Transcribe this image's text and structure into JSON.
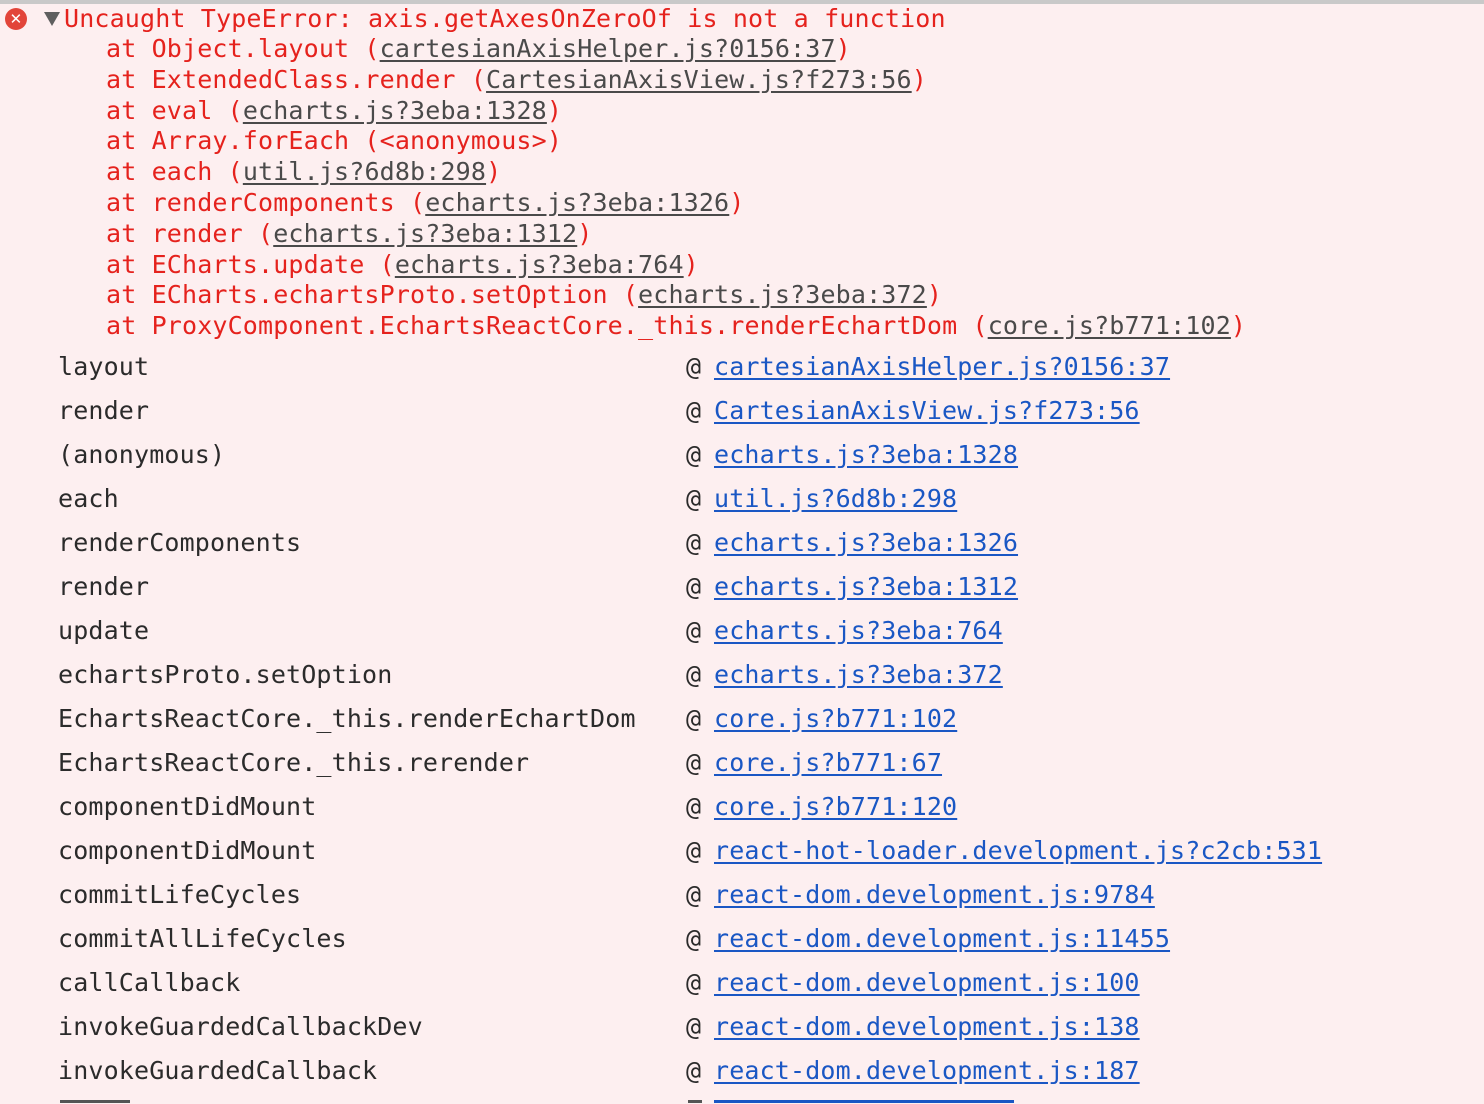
{
  "error": {
    "icon": "error-circle-icon",
    "icon_glyph": "✕",
    "message": "Uncaught TypeError: axis.getAxesOnZeroOf is not a function",
    "color": "#e5221d"
  },
  "trace": [
    {
      "prefix": "at Object.layout ",
      "location": "cartesianAxisHelper.js?0156:37"
    },
    {
      "prefix": "at ExtendedClass.render ",
      "location": "CartesianAxisView.js?f273:56"
    },
    {
      "prefix": "at eval ",
      "location": "echarts.js?3eba:1328"
    },
    {
      "prefix": "at Array.forEach ",
      "location": "<anonymous>"
    },
    {
      "prefix": "at each ",
      "location": "util.js?6d8b:298"
    },
    {
      "prefix": "at renderComponents ",
      "location": "echarts.js?3eba:1326"
    },
    {
      "prefix": "at render ",
      "location": "echarts.js?3eba:1312"
    },
    {
      "prefix": "at ECharts.update ",
      "location": "echarts.js?3eba:764"
    },
    {
      "prefix": "at ECharts.echartsProto.setOption ",
      "location": "echarts.js?3eba:372"
    },
    {
      "prefix": "at ProxyComponent.EchartsReactCore._this.renderEchartDom ",
      "location": "core.js?b771:102"
    }
  ],
  "stack": [
    {
      "fn": "layout",
      "at": "@",
      "link": "cartesianAxisHelper.js?0156:37"
    },
    {
      "fn": "render",
      "at": "@",
      "link": "CartesianAxisView.js?f273:56"
    },
    {
      "fn": "(anonymous)",
      "at": "@",
      "link": "echarts.js?3eba:1328"
    },
    {
      "fn": "each",
      "at": "@",
      "link": "util.js?6d8b:298"
    },
    {
      "fn": "renderComponents",
      "at": "@",
      "link": "echarts.js?3eba:1326"
    },
    {
      "fn": "render",
      "at": "@",
      "link": "echarts.js?3eba:1312"
    },
    {
      "fn": "update",
      "at": "@",
      "link": "echarts.js?3eba:764"
    },
    {
      "fn": "echartsProto.setOption",
      "at": "@",
      "link": "echarts.js?3eba:372"
    },
    {
      "fn": "EchartsReactCore._this.renderEchartDom",
      "at": "@",
      "link": "core.js?b771:102"
    },
    {
      "fn": "EchartsReactCore._this.rerender",
      "at": "@",
      "link": "core.js?b771:67"
    },
    {
      "fn": "componentDidMount",
      "at": "@",
      "link": "core.js?b771:120"
    },
    {
      "fn": "componentDidMount",
      "at": "@",
      "link": "react-hot-loader.development.js?c2cb:531"
    },
    {
      "fn": "commitLifeCycles",
      "at": "@",
      "link": "react-dom.development.js:9784"
    },
    {
      "fn": "commitAllLifeCycles",
      "at": "@",
      "link": "react-dom.development.js:11455"
    },
    {
      "fn": "callCallback",
      "at": "@",
      "link": "react-dom.development.js:100"
    },
    {
      "fn": "invokeGuardedCallbackDev",
      "at": "@",
      "link": "react-dom.development.js:138"
    },
    {
      "fn": "invokeGuardedCallback",
      "at": "@",
      "link": "react-dom.development.js:187"
    }
  ],
  "colors": {
    "background": "#fdeff0",
    "error_text": "#e5221d",
    "link": "#1a57c4",
    "plain_text": "#2b2b2b"
  }
}
